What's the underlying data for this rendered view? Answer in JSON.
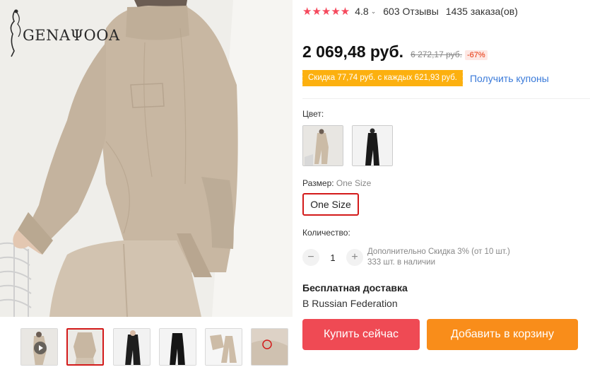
{
  "brand": {
    "logo_text": "GENAΨOOA"
  },
  "rating": {
    "stars": "★★★★★",
    "value": "4.8",
    "caret": "⌄",
    "reviews": "603 Отзывы",
    "orders": "1435 заказа(ов)"
  },
  "price": {
    "current": "2 069,48 руб.",
    "old": "6 272,17 руб.",
    "discount": "-67%"
  },
  "coupon": {
    "tag": "Скидка 77,74 руб. с каждых 621,93 руб.",
    "link": "Получить купоны"
  },
  "color": {
    "label": "Цвет:"
  },
  "size": {
    "label": "Размер:",
    "selected": "One Size",
    "option": "One Size"
  },
  "quantity": {
    "label": "Количество:",
    "minus": "−",
    "value": "1",
    "plus": "+",
    "discount_note": "Дополнительно Скидка 3% (от 10 шт.)",
    "stock": "333 шт. в наличии"
  },
  "shipping": {
    "title": "Бесплатная доставка",
    "destination": "В Russian Federation"
  },
  "buttons": {
    "buy": "Купить сейчас",
    "cart": "Добавить в корзину"
  },
  "colors": {
    "accent": "#d31a1a",
    "star": "#f5495d",
    "buy": "#ef4a54",
    "cart": "#f98d1a",
    "coupon": "#fcb00f",
    "link": "#3a7ad9"
  }
}
